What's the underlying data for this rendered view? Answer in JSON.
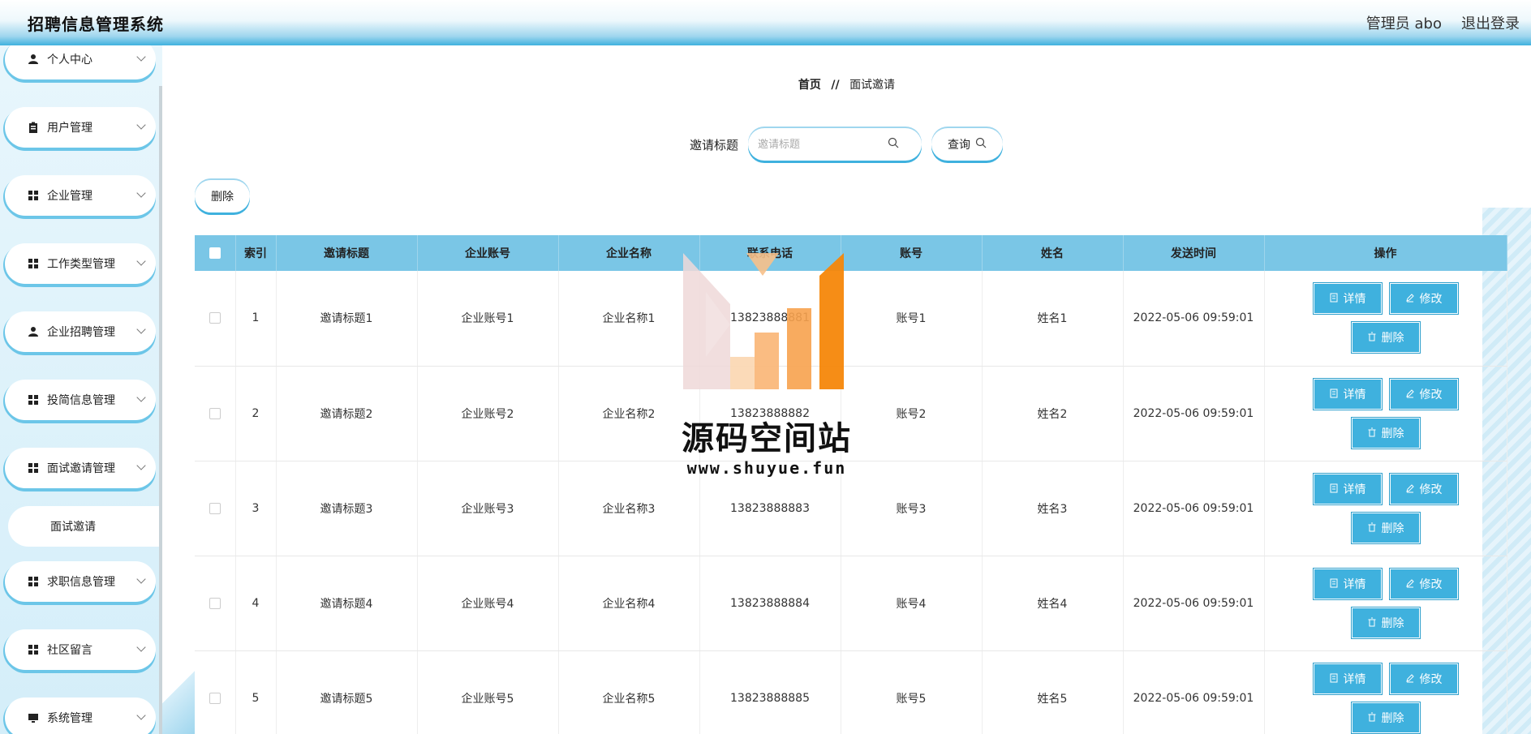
{
  "app": {
    "title": "招聘信息管理系统"
  },
  "header": {
    "user_label": "管理员 abo",
    "logout_label": "退出登录"
  },
  "sidebar": {
    "items": [
      {
        "label": "个人中心",
        "icon": "user-icon"
      },
      {
        "label": "用户管理",
        "icon": "clipboard-icon"
      },
      {
        "label": "企业管理",
        "icon": "grid-icon"
      },
      {
        "label": "工作类型管理",
        "icon": "grid-icon"
      },
      {
        "label": "企业招聘管理",
        "icon": "user-icon"
      },
      {
        "label": "投简信息管理",
        "icon": "grid-icon"
      },
      {
        "label": "面试邀请管理",
        "icon": "grid-icon"
      },
      {
        "label": "求职信息管理",
        "icon": "grid-icon"
      },
      {
        "label": "社区留言",
        "icon": "grid-icon"
      },
      {
        "label": "系统管理",
        "icon": "monitor-icon"
      }
    ],
    "active_sub": "面试邀请"
  },
  "breadcrumb": {
    "home": "首页",
    "separator": "//",
    "current": "面试邀请"
  },
  "search": {
    "label": "邀请标题",
    "placeholder": "邀请标题",
    "button_label": "查询"
  },
  "toolbar": {
    "delete_label": "删除"
  },
  "table": {
    "columns": [
      "索引",
      "邀请标题",
      "企业账号",
      "企业名称",
      "联系电话",
      "账号",
      "姓名",
      "发送时间",
      "操作"
    ],
    "rows": [
      {
        "index": "1",
        "title": "邀请标题1",
        "company_account": "企业账号1",
        "company_name": "企业名称1",
        "phone": "13823888881",
        "account": "账号1",
        "name": "姓名1",
        "time": "2022-05-06 09:59:01"
      },
      {
        "index": "2",
        "title": "邀请标题2",
        "company_account": "企业账号2",
        "company_name": "企业名称2",
        "phone": "13823888882",
        "account": "账号2",
        "name": "姓名2",
        "time": "2022-05-06 09:59:01"
      },
      {
        "index": "3",
        "title": "邀请标题3",
        "company_account": "企业账号3",
        "company_name": "企业名称3",
        "phone": "13823888883",
        "account": "账号3",
        "name": "姓名3",
        "time": "2022-05-06 09:59:01"
      },
      {
        "index": "4",
        "title": "邀请标题4",
        "company_account": "企业账号4",
        "company_name": "企业名称4",
        "phone": "13823888884",
        "account": "账号4",
        "name": "姓名4",
        "time": "2022-05-06 09:59:01"
      },
      {
        "index": "5",
        "title": "邀请标题5",
        "company_account": "企业账号5",
        "company_name": "企业名称5",
        "phone": "13823888885",
        "account": "账号5",
        "name": "姓名5",
        "time": "2022-05-06 09:59:01"
      }
    ],
    "actions": {
      "detail": "详情",
      "edit": "修改",
      "delete": "删除"
    }
  },
  "watermark": {
    "title": "源码空间站",
    "url": "www.shuyue.fun"
  },
  "colors": {
    "accent": "#3fb1de",
    "header_row": "#7ac6e6",
    "sidebar_bg": "#d4eef9"
  }
}
